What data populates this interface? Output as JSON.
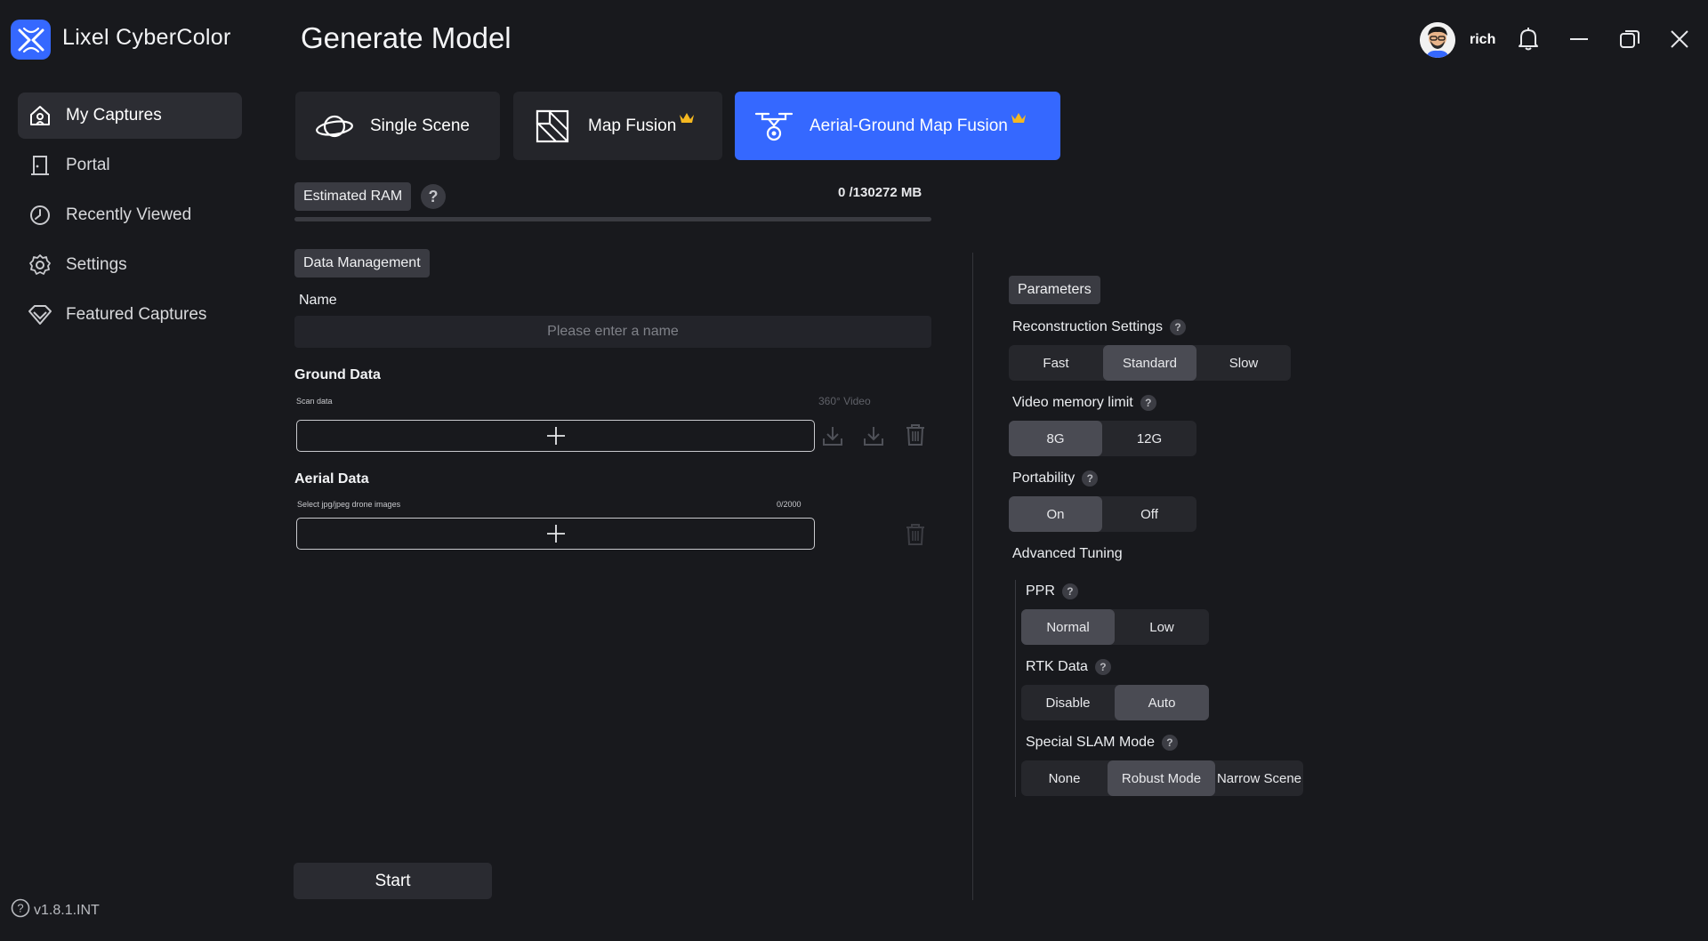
{
  "app": {
    "name": "Lixel CyberColor",
    "version": "v1.8.1.INT"
  },
  "sidebar": {
    "items": [
      {
        "label": "My Captures",
        "icon": "home-icon",
        "active": true
      },
      {
        "label": "Portal",
        "icon": "door-icon",
        "active": false
      },
      {
        "label": "Recently Viewed",
        "icon": "clock-icon",
        "active": false
      },
      {
        "label": "Settings",
        "icon": "gear-icon",
        "active": false
      },
      {
        "label": "Featured Captures",
        "icon": "diamond-icon",
        "active": false
      }
    ]
  },
  "header": {
    "title": "Generate Model",
    "user": "rich"
  },
  "modes": [
    {
      "label": "Single Scene",
      "icon": "planet-icon",
      "premium": false,
      "active": false
    },
    {
      "label": "Map Fusion",
      "icon": "map-fusion-icon",
      "premium": true,
      "active": false
    },
    {
      "label": "Aerial-Ground Map Fusion",
      "icon": "drone-icon",
      "premium": true,
      "active": true
    }
  ],
  "ram": {
    "label": "Estimated RAM",
    "used": 0,
    "total": 130272,
    "text": "0 /130272 MB"
  },
  "data_management": {
    "label": "Data Management",
    "name_label": "Name",
    "name_placeholder": "Please enter a name",
    "name_value": "",
    "ground": {
      "title": "Ground Data",
      "hint": "Scan data",
      "video_label": "360° Video"
    },
    "aerial": {
      "title": "Aerial Data",
      "hint": "Select jpg/jpeg drone images",
      "count": "0/2000"
    }
  },
  "start_label": "Start",
  "parameters": {
    "label": "Parameters",
    "reconstruction": {
      "label": "Reconstruction Settings",
      "options": [
        "Fast",
        "Standard",
        "Slow"
      ],
      "selected": "Standard"
    },
    "video_memory": {
      "label": "Video memory limit",
      "options": [
        "8G",
        "12G"
      ],
      "selected": "8G"
    },
    "portability": {
      "label": "Portability",
      "options": [
        "On",
        "Off"
      ],
      "selected": "On"
    },
    "advanced": {
      "label": "Advanced Tuning",
      "ppr": {
        "label": "PPR",
        "options": [
          "Normal",
          "Low"
        ],
        "selected": "Normal"
      },
      "rtk": {
        "label": "RTK Data",
        "options": [
          "Disable",
          "Auto"
        ],
        "selected": "Auto"
      },
      "slam": {
        "label": "Special SLAM Mode",
        "options": [
          "None",
          "Robust Mode",
          "Narrow Scene"
        ],
        "selected": "Robust Mode"
      }
    }
  },
  "colors": {
    "accent": "#3568ff",
    "background": "#18191d",
    "crown": "#f5b820"
  }
}
